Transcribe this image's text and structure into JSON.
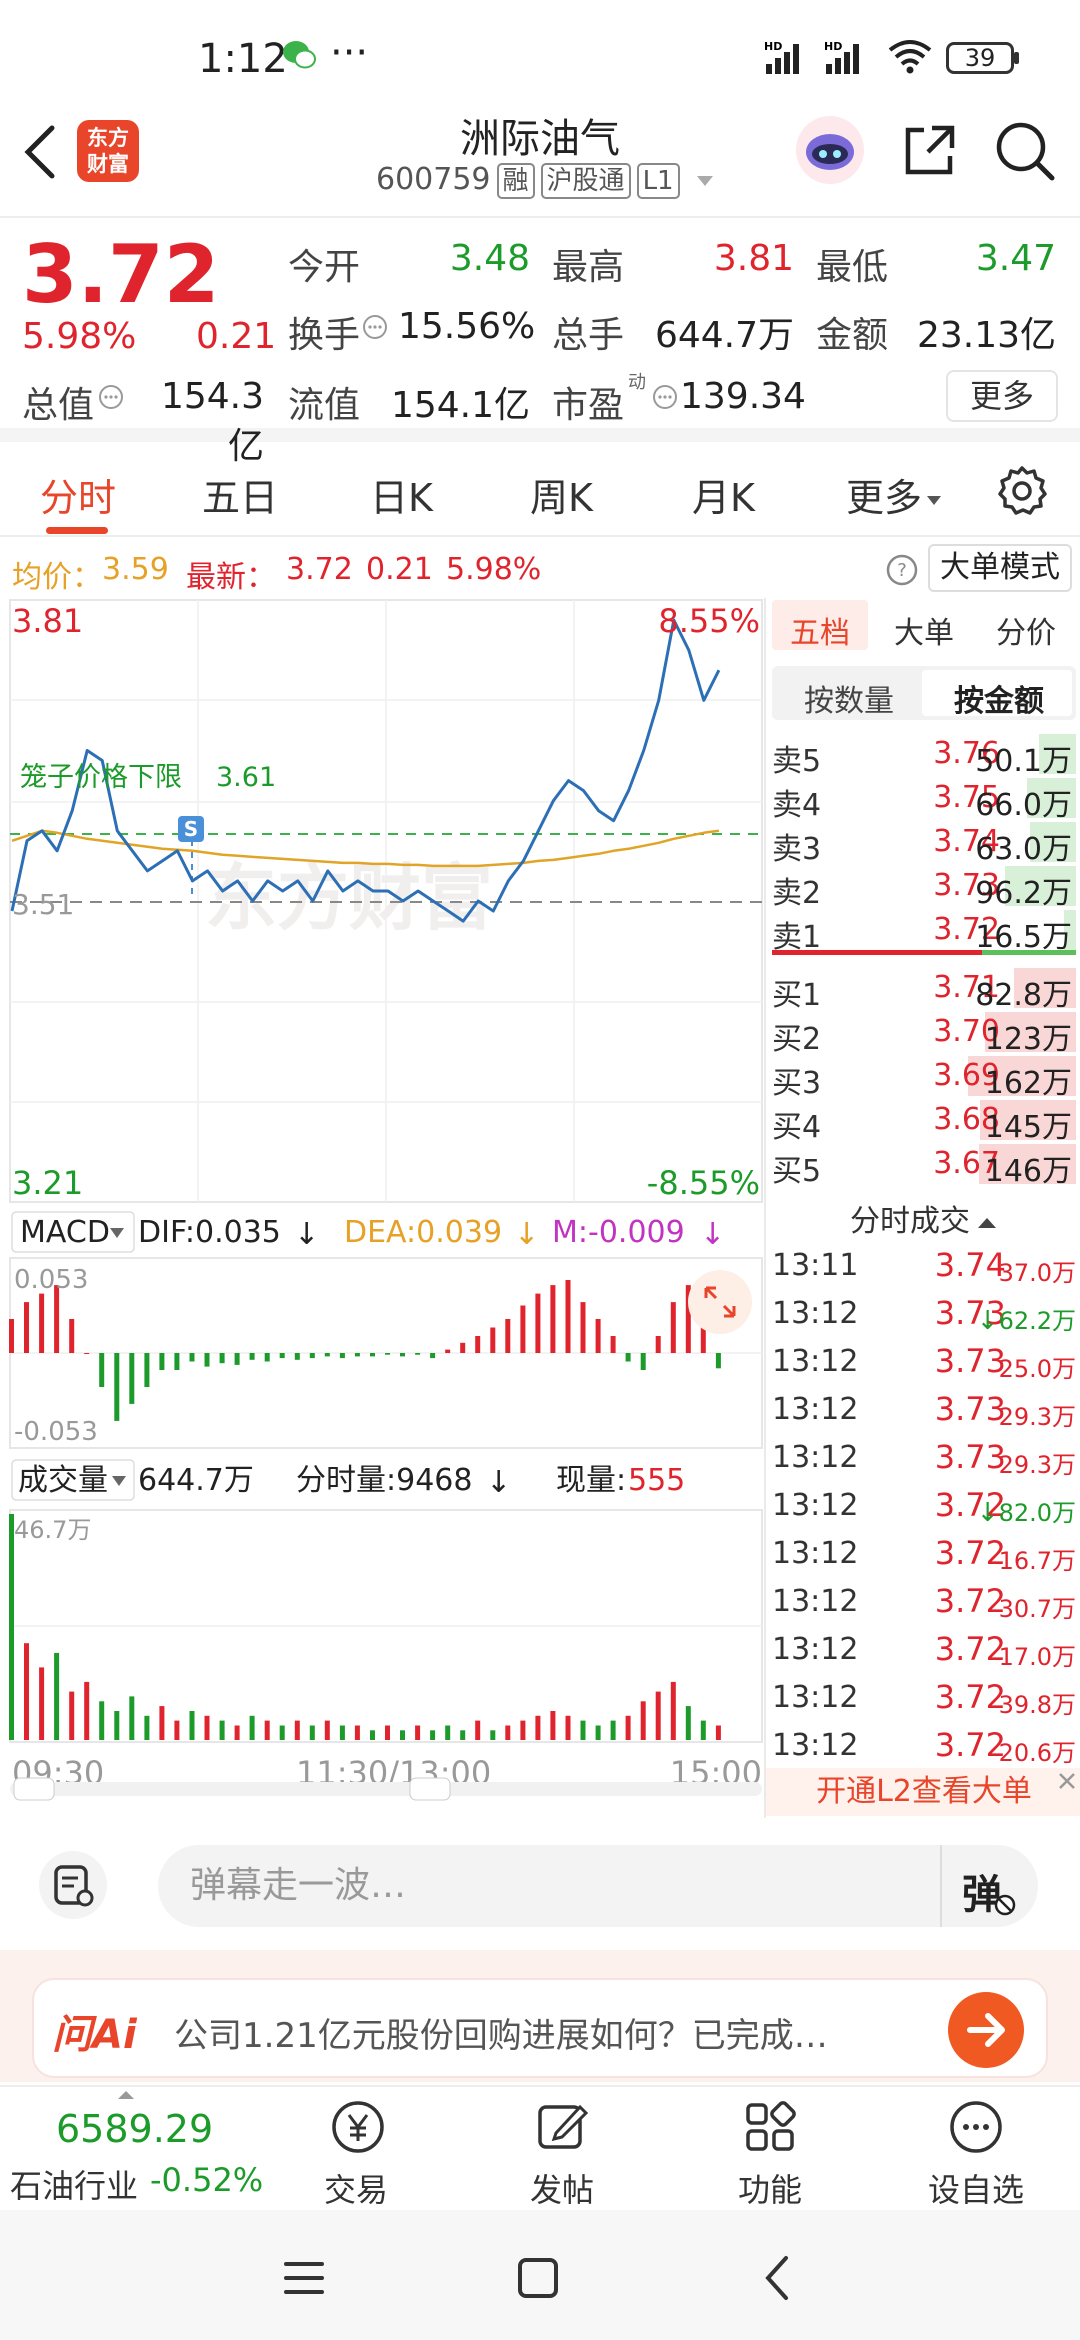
{
  "status_bar": {
    "time": "1:12",
    "dots": "···",
    "battery": "39"
  },
  "header": {
    "logo_line1": "东方",
    "logo_line2": "财富",
    "stock_name": "洲际油气",
    "stock_code": "600759",
    "tags": [
      "融",
      "沪股通",
      "L1"
    ]
  },
  "quote": {
    "price": "3.72",
    "change_pct": "5.98%",
    "change_abs": "0.21",
    "open_label": "今开",
    "open": "3.48",
    "high_label": "最高",
    "high": "3.81",
    "low_label": "最低",
    "low": "3.47",
    "turnover_label": "换手",
    "turnover": "15.56%",
    "volume_label": "总手",
    "volume": "644.7万",
    "amount_label": "金额",
    "amount": "23.13亿",
    "mktcap_label": "总值",
    "mktcap": "154.3亿",
    "float_label": "流值",
    "float": "154.1亿",
    "pe_label": "市盈",
    "pe_sup": "动",
    "pe": "139.34",
    "more_label": "更多"
  },
  "tabs": [
    "分时",
    "五日",
    "日K",
    "周K",
    "月K",
    "更多"
  ],
  "info_row": {
    "avg_label": "均价：",
    "avg": "3.59",
    "last_label": "最新：",
    "last": "3.72",
    "chg": "0.21",
    "pct": "5.98%",
    "big_order_mode": "大单模式"
  },
  "chart_labels": {
    "price_top": "3.81",
    "price_mid": "3.51",
    "price_bot": "3.21",
    "pct_top": "8.55%",
    "pct_bot": "-8.55%",
    "limit_label": "笼子价格下限",
    "limit_value": "3.61",
    "watermark": "东方财富",
    "macd_label": "MACD",
    "dif": "DIF:0.035",
    "dea": "DEA:0.039",
    "m": "M:-0.009",
    "macd_top": "0.053",
    "macd_bot": "-0.053",
    "vol_label": "成交量",
    "vol_total": "644.7万",
    "vol_minute": "分时量:9468",
    "vol_now_label": "现量:",
    "vol_now": "555",
    "vol_max": "46.7万",
    "time_start": "09:30",
    "time_mid": "11:30/13:00",
    "time_end": "15:00"
  },
  "chart_data": {
    "type": "line",
    "title": "",
    "x_axis_ticks": [
      "09:30",
      "11:30/13:00",
      "15:00"
    ],
    "ylim": [
      3.21,
      3.81
    ],
    "prev_close": 3.51,
    "series": [
      {
        "name": "",
        "values": [
          3.5,
          3.57,
          3.58,
          3.56,
          3.6,
          3.66,
          3.65,
          3.58,
          3.56,
          3.54,
          3.55,
          3.56,
          3.53,
          3.54,
          3.52,
          3.53,
          3.51,
          3.53,
          3.52,
          3.53,
          3.51,
          3.54,
          3.52,
          3.53,
          3.52,
          3.52,
          3.51,
          3.52,
          3.51,
          3.5,
          3.49,
          3.51,
          3.5,
          3.53,
          3.55,
          3.58,
          3.61,
          3.63,
          3.62,
          3.6,
          3.59,
          3.62,
          3.66,
          3.71,
          3.79,
          3.76,
          3.71,
          3.74
        ]
      },
      {
        "name": "",
        "values": [
          3.57,
          3.575,
          3.58,
          3.578,
          3.575,
          3.572,
          3.57,
          3.568,
          3.566,
          3.564,
          3.562,
          3.561,
          3.56,
          3.558,
          3.556,
          3.555,
          3.554,
          3.553,
          3.552,
          3.551,
          3.55,
          3.549,
          3.548,
          3.548,
          3.547,
          3.547,
          3.546,
          3.546,
          3.545,
          3.545,
          3.545,
          3.545,
          3.546,
          3.547,
          3.548,
          3.55,
          3.551,
          3.553,
          3.555,
          3.557,
          3.56,
          3.562,
          3.565,
          3.568,
          3.572,
          3.575,
          3.578,
          3.58
        ]
      }
    ],
    "volume_values": [
      46.7,
      20,
      15,
      18,
      10,
      12,
      8,
      6,
      9,
      5,
      7,
      4,
      6,
      5,
      4,
      3,
      5,
      4,
      3,
      4,
      3,
      4,
      3,
      3,
      2,
      3,
      2,
      3,
      2,
      3,
      2,
      4,
      2,
      3,
      4,
      5,
      6,
      5,
      4,
      3,
      4,
      5,
      8,
      10,
      12,
      7,
      4,
      3
    ],
    "macd_values": [
      0.02,
      0.03,
      0.035,
      0.04,
      0.02,
      0.0,
      -0.02,
      -0.04,
      -0.03,
      -0.02,
      -0.01,
      -0.01,
      -0.005,
      -0.008,
      -0.006,
      -0.007,
      -0.004,
      -0.005,
      -0.003,
      -0.004,
      -0.003,
      -0.002,
      -0.003,
      -0.002,
      -0.002,
      -0.001,
      -0.002,
      -0.001,
      -0.003,
      0.002,
      0.006,
      0.01,
      0.015,
      0.02,
      0.028,
      0.035,
      0.04,
      0.043,
      0.03,
      0.02,
      0.01,
      -0.005,
      -0.01,
      0.01,
      0.03,
      0.04,
      0.02,
      -0.009
    ]
  },
  "right_panel": {
    "tabs": [
      "五档",
      "大单",
      "分价"
    ],
    "sub_tabs": [
      "按数量",
      "按金额"
    ],
    "asks": [
      {
        "label": "卖5",
        "price": "3.76",
        "vol": "50.1万",
        "ratio": 0.34
      },
      {
        "label": "卖4",
        "price": "3.75",
        "vol": "66.0万",
        "ratio": 0.45
      },
      {
        "label": "卖3",
        "price": "3.74",
        "vol": "63.0万",
        "ratio": 0.43
      },
      {
        "label": "卖2",
        "price": "3.73",
        "vol": "96.2万",
        "ratio": 0.66
      },
      {
        "label": "卖1",
        "price": "3.72",
        "vol": "16.5万",
        "ratio": 0.11
      }
    ],
    "bids": [
      {
        "label": "买1",
        "price": "3.71",
        "vol": "82.8万",
        "ratio": 0.57
      },
      {
        "label": "买2",
        "price": "3.70",
        "vol": "123万",
        "ratio": 0.84
      },
      {
        "label": "买3",
        "price": "3.69",
        "vol": "162万",
        "ratio": 1.0
      },
      {
        "label": "买4",
        "price": "3.68",
        "vol": "145万",
        "ratio": 0.89
      },
      {
        "label": "买5",
        "price": "3.67",
        "vol": "146万",
        "ratio": 0.9
      }
    ],
    "trades_title": "分时成交",
    "trades": [
      {
        "time": "13:11",
        "price": "3.74",
        "vol": "37.0万",
        "arrow": "",
        "color": "red"
      },
      {
        "time": "13:12",
        "price": "3.73",
        "vol": "62.2万",
        "arrow": "↓",
        "color": "green"
      },
      {
        "time": "13:12",
        "price": "3.73",
        "vol": "25.0万",
        "arrow": "",
        "color": "red"
      },
      {
        "time": "13:12",
        "price": "3.73",
        "vol": "29.3万",
        "arrow": "",
        "color": "red"
      },
      {
        "time": "13:12",
        "price": "3.73",
        "vol": "29.3万",
        "arrow": "",
        "color": "red"
      },
      {
        "time": "13:12",
        "price": "3.72",
        "vol": "82.0万",
        "arrow": "↓",
        "color": "green"
      },
      {
        "time": "13:12",
        "price": "3.72",
        "vol": "16.7万",
        "arrow": "",
        "color": "red"
      },
      {
        "time": "13:12",
        "price": "3.72",
        "vol": "30.7万",
        "arrow": "",
        "color": "red"
      },
      {
        "time": "13:12",
        "price": "3.72",
        "vol": "17.0万",
        "arrow": "",
        "color": "red"
      },
      {
        "time": "13:12",
        "price": "3.72",
        "vol": "39.8万",
        "arrow": "",
        "color": "red"
      },
      {
        "time": "13:12",
        "price": "3.72",
        "vol": "20.6万",
        "arrow": "",
        "color": "red"
      }
    ],
    "l2_banner": "开通L2查看大单"
  },
  "comment_bar": {
    "placeholder": "弹幕走一波…",
    "danmu_label": "弹"
  },
  "ai_bar": {
    "logo": "问Ai",
    "question": "公司1.21亿元股份回购进展如何？已完成…"
  },
  "bottom_nav": {
    "index_value": "6589.29",
    "index_name": "石油行业",
    "index_pct": "-0.52%",
    "items": [
      "交易",
      "发帖",
      "功能",
      "设自选"
    ]
  },
  "colors": {
    "up": "#e0242e",
    "down": "#1c9b2a",
    "brand": "#e8452b",
    "price_line": "#2c6fb5",
    "avg_line": "#e0a526"
  }
}
